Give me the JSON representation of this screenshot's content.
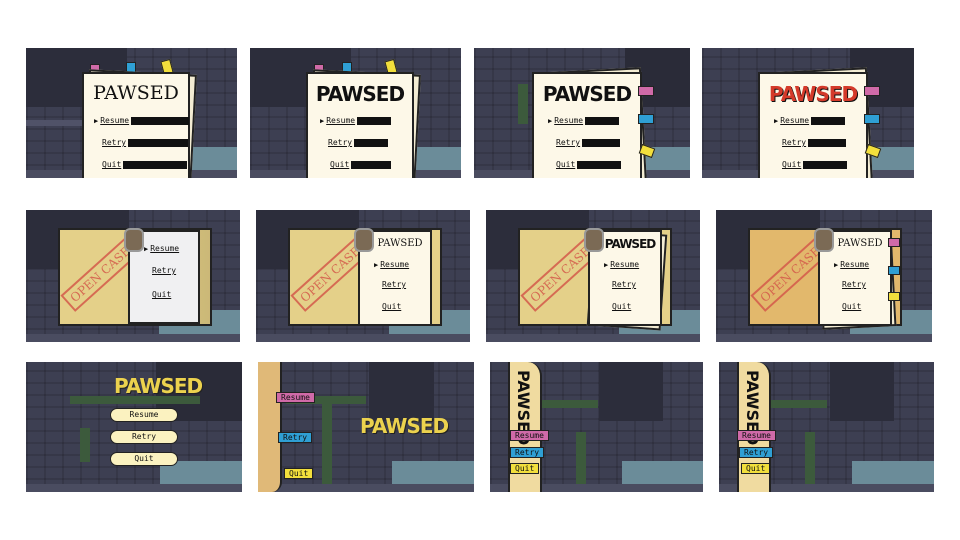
{
  "title_text": "PAWSED",
  "menu": {
    "resume": "Resume",
    "retry": "Retry",
    "quit": "Quit"
  },
  "stamp_text": "OPEN CASE:",
  "selector_glyph": "▶",
  "colors": {
    "tab_pink": "#d06aa8",
    "tab_blue": "#2f9fd4",
    "tab_yellow": "#f2df3c",
    "title_red": "#d43a2a",
    "title_yellow": "#ecd24e",
    "folder": "#e4d089",
    "paper": "#fdf8e8",
    "stamp_red": "#d45a4a"
  },
  "frames": [
    {
      "row": 1,
      "col": 1,
      "variant": "paper-serif-title"
    },
    {
      "row": 1,
      "col": 2,
      "variant": "paper-bold-title"
    },
    {
      "row": 1,
      "col": 3,
      "variant": "paper-side-tabs"
    },
    {
      "row": 1,
      "col": 4,
      "variant": "paper-red-title"
    },
    {
      "row": 2,
      "col": 1,
      "variant": "folder-no-title"
    },
    {
      "row": 2,
      "col": 2,
      "variant": "folder-title"
    },
    {
      "row": 2,
      "col": 3,
      "variant": "folder-bold-title"
    },
    {
      "row": 2,
      "col": 4,
      "variant": "folder-tabs"
    },
    {
      "row": 3,
      "col": 1,
      "variant": "pills-center"
    },
    {
      "row": 3,
      "col": 2,
      "variant": "spine-horizontal-title"
    },
    {
      "row": 3,
      "col": 3,
      "variant": "spine-vertical-title"
    },
    {
      "row": 3,
      "col": 4,
      "variant": "spine-vertical-title-2"
    }
  ]
}
